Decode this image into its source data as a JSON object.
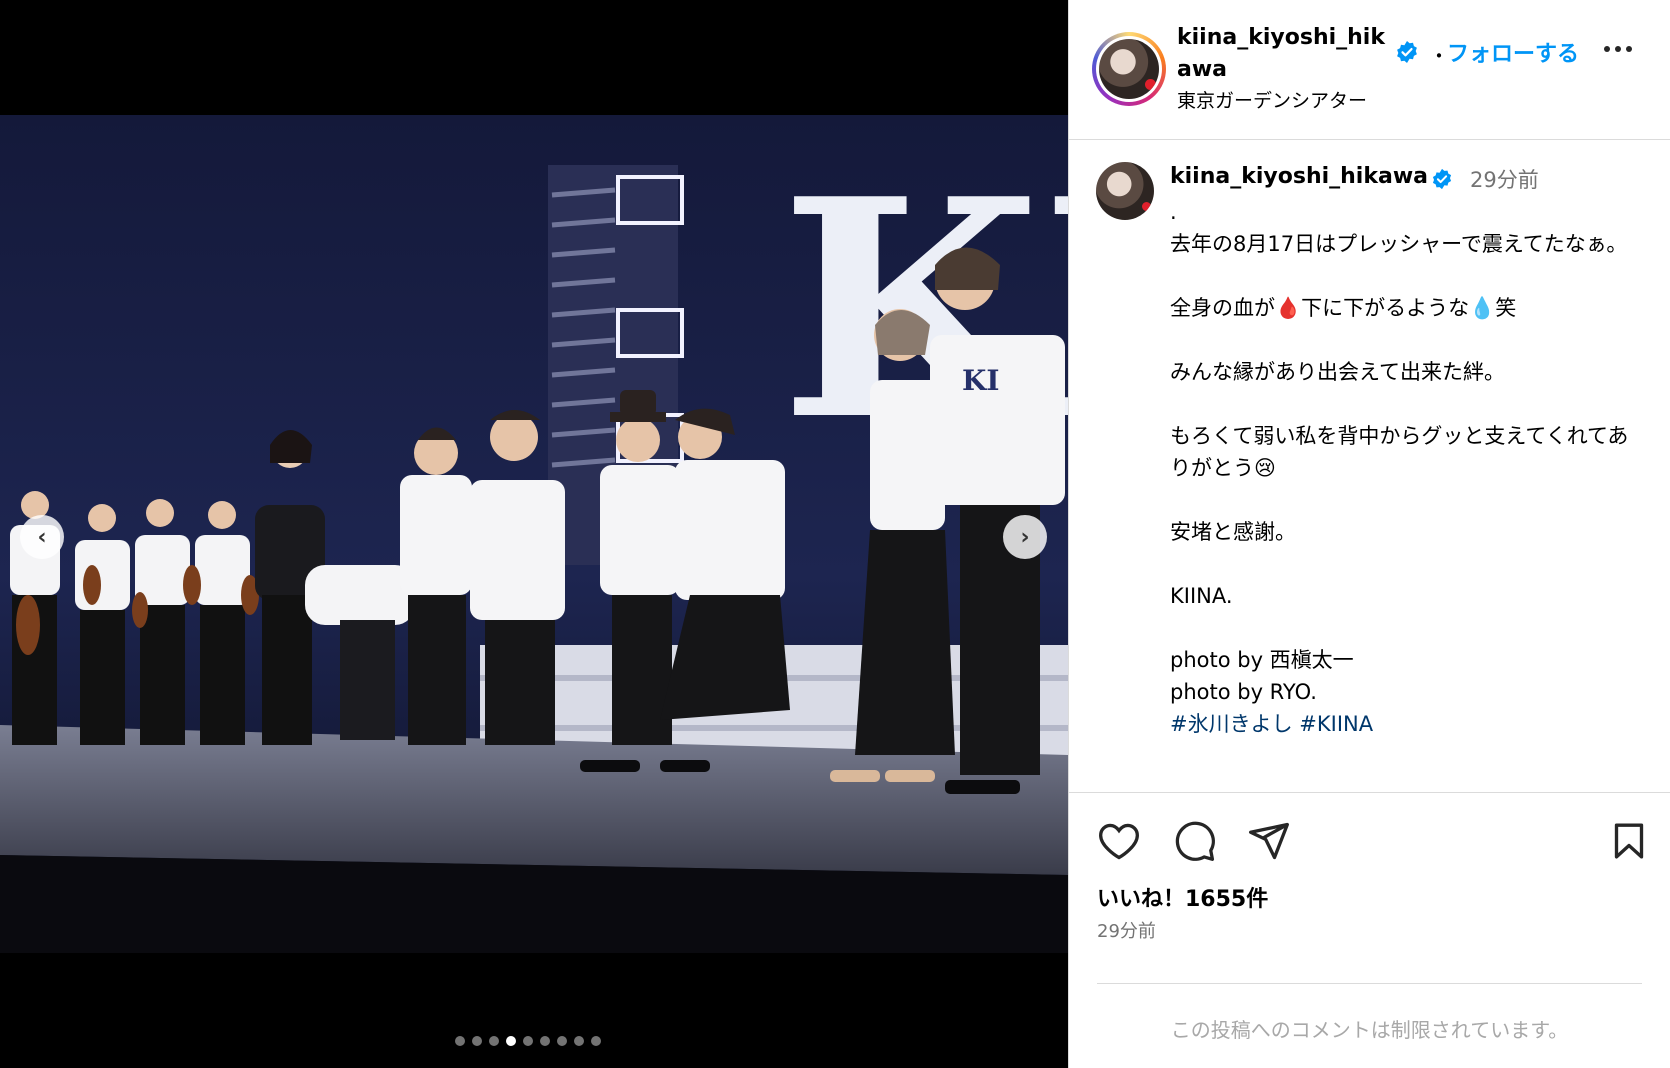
{
  "post": {
    "username": "kiina_kiyoshi_hikawa",
    "location": "東京ガーデンシアター",
    "follow_label": "フォローする",
    "separator": "・",
    "caption_time": "29分前",
    "caption_lines": [
      ".",
      "去年の8月17日はプレッシャーで震えてたなぁ。",
      "",
      "全身の血が🩸下に下がるような💧笑",
      "",
      "みんな縁があり出会えて出来た絆。",
      "",
      "もろくて弱い私を背中からグッと支えてくれてありがとう😢",
      "",
      "安堵と感謝。",
      "",
      "KIINA.",
      "",
      "photo by 西槇太一",
      "photo by RYO."
    ],
    "hashtags": "#氷川きよし #KIINA",
    "likes": "いいね！1655件",
    "time": "29分前",
    "comments_disabled": "この投稿へのコメントは制限されています。"
  },
  "media": {
    "slide_count": 9,
    "active_slide": 4,
    "stage_logo": "KI",
    "shirt_logo": "KI"
  },
  "colors": {
    "accent": "#0095f6",
    "verified": "#0095f6",
    "muted": "#737373"
  },
  "icons": [
    "chevron-left-icon",
    "chevron-right-icon",
    "verified-badge-icon",
    "more-icon",
    "heart-icon",
    "comment-icon",
    "share-icon",
    "bookmark-icon"
  ]
}
